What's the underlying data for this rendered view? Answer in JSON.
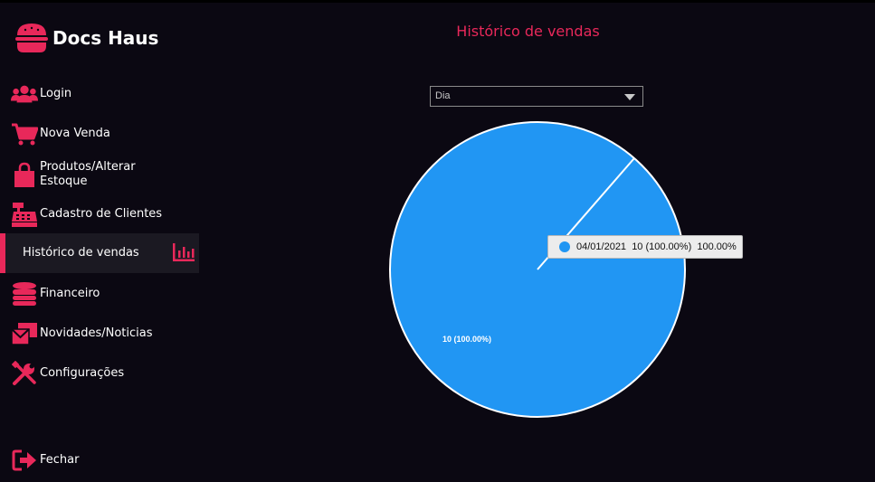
{
  "brand": {
    "name": "Docs Haus",
    "icon": "burger-icon"
  },
  "nav": {
    "items": [
      {
        "label": "Login",
        "icon": "users-icon"
      },
      {
        "label": "Nova Venda",
        "icon": "cart-icon"
      },
      {
        "label": "Produtos/Alterar\nEstoque",
        "icon": "shopping-bag-icon"
      },
      {
        "label": "Cadastro de Clientes",
        "icon": "cash-register-icon"
      },
      {
        "label": "Histórico de vendas",
        "icon": "bar-chart-icon",
        "active": true
      },
      {
        "label": "Financeiro",
        "icon": "coins-icon"
      },
      {
        "label": "Novidades/Noticias",
        "icon": "mail-icon"
      },
      {
        "label": "Configurações",
        "icon": "tools-icon"
      }
    ],
    "logout": {
      "label": "Fechar",
      "icon": "sign-out-icon"
    }
  },
  "main": {
    "title": "Histórico de vendas",
    "period_select": {
      "value": "Dia"
    }
  },
  "chart_data": {
    "type": "pie",
    "slices": [
      {
        "label": "04/01/2021",
        "value": 10,
        "percent": 100.0,
        "color": "#2196f3",
        "data_label": "10 (100.00%)"
      }
    ],
    "tooltip": {
      "label": "04/01/2021",
      "value_text": "10 (100.00%)",
      "percent_text": "100.00%"
    }
  },
  "colors": {
    "accent": "#e8285a",
    "background": "#0b0812",
    "active_item_bg": "#1b1922",
    "slice": "#2196f3"
  }
}
